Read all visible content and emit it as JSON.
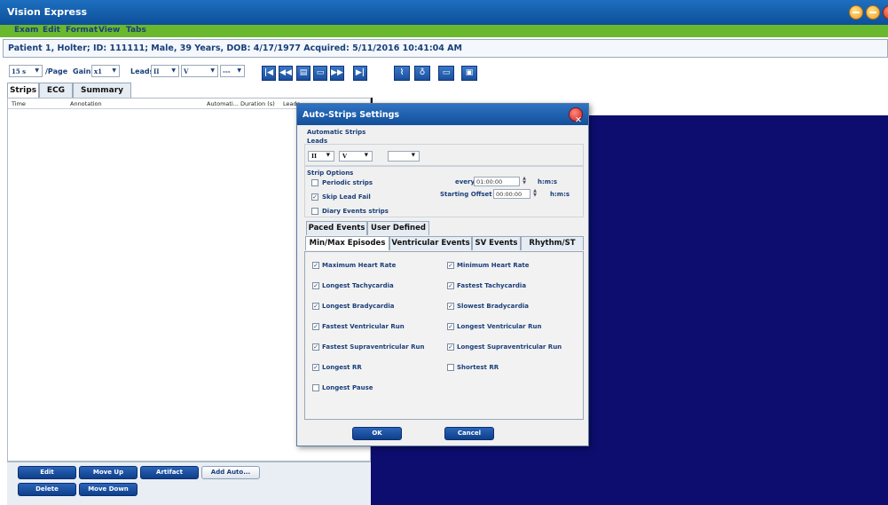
{
  "app": {
    "title": "Vision Express"
  },
  "menu": [
    "Exam",
    "Edit",
    "Format",
    "View",
    "Tabs"
  ],
  "patient_info": "Patient 1, Holter; ID: 111111; Male, 39 Years, DOB: 4/17/1977 Acquired: 5/11/2016 10:41:04 AM",
  "toolbar": {
    "page_value": "15 s",
    "page_label": "/Page",
    "gain_label": "Gain",
    "gain_value": "x1",
    "leads_label": "Leads",
    "lead1": "II",
    "lead2": "V",
    "lead3": "---"
  },
  "main_tabs": [
    "Strips",
    "ECG",
    "Summary"
  ],
  "strips_table": {
    "columns": [
      "Time",
      "Annotation",
      "Automati...",
      "Duration (s)",
      "Leads"
    ]
  },
  "left_buttons": {
    "edit": "Edit",
    "move_up": "Move Up",
    "artifact": "Artifact",
    "add_auto": "Add Auto...",
    "delete": "Delete",
    "move_down": "Move Down"
  },
  "dialog": {
    "title": "Auto-Strips Settings",
    "automatic_strips": "Automatic Strips",
    "leads_label": "Leads",
    "lead1": "II",
    "lead2": "V",
    "lead3": "",
    "strip_options": "Strip Options",
    "periodic_strips": "Periodic strips",
    "periodic_checked": false,
    "skip_lead_fail": "Skip Lead Fail",
    "skip_checked": true,
    "diary_events": "Diary Events strips",
    "diary_checked": false,
    "every_label": "every",
    "every_value": "01:00:00",
    "every_unit": "h:m:s",
    "offset_label": "Starting Offset",
    "offset_value": "00:00:00",
    "offset_unit": "h:m:s",
    "tabs_row1": [
      "Paced Events",
      "User Defined"
    ],
    "tabs_row2": [
      "Min/Max Episodes",
      "Ventricular Events",
      "SV Events",
      "Rhythm/ST"
    ],
    "episodes": [
      {
        "label": "Maximum Heart Rate",
        "checked": true
      },
      {
        "label": "Minimum Heart Rate",
        "checked": true
      },
      {
        "label": "Longest Tachycardia",
        "checked": true
      },
      {
        "label": "Fastest Tachycardia",
        "checked": true
      },
      {
        "label": "Longest Bradycardia",
        "checked": true
      },
      {
        "label": "Slowest Bradycardia",
        "checked": true
      },
      {
        "label": "Fastest Ventricular Run",
        "checked": true
      },
      {
        "label": "Longest Ventricular Run",
        "checked": true
      },
      {
        "label": "Fastest Supraventricular Run",
        "checked": true
      },
      {
        "label": "Longest Supraventricular Run",
        "checked": true
      },
      {
        "label": "Longest RR",
        "checked": true
      },
      {
        "label": "Shortest RR",
        "checked": false
      },
      {
        "label": "Longest Pause",
        "checked": false
      }
    ],
    "ok": "OK",
    "cancel": "Cancel"
  }
}
